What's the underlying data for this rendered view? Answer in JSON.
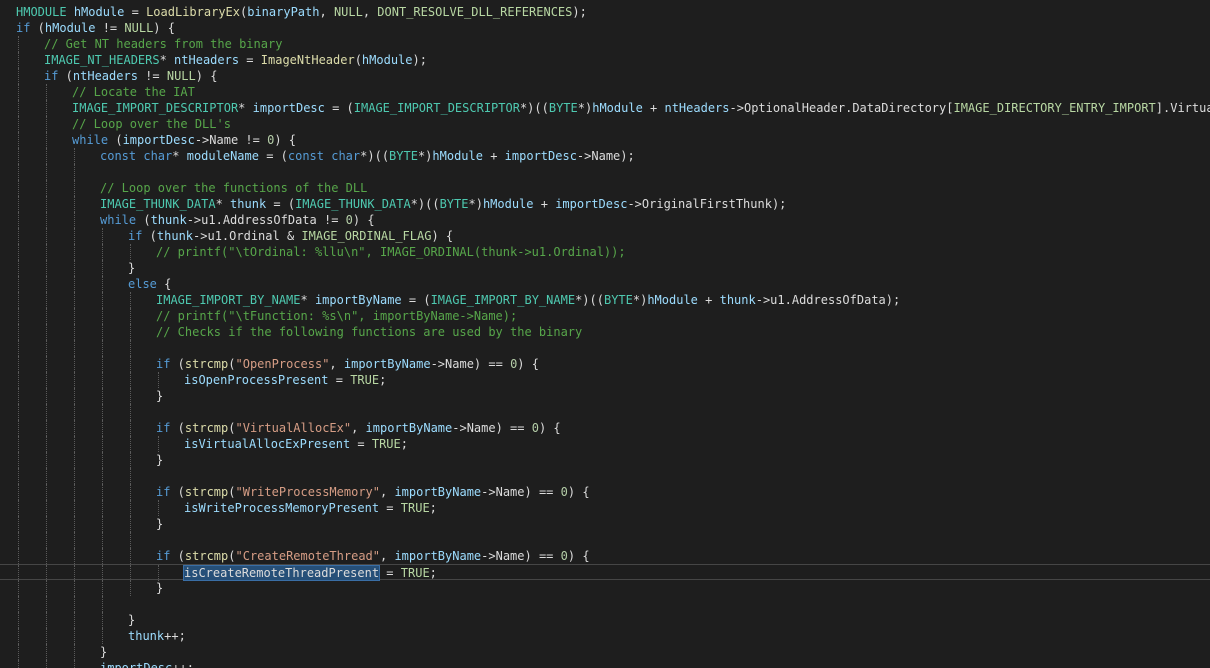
{
  "editor": {
    "language": "C++",
    "colors": {
      "background": "#1e1e1e",
      "keyword": "#569cd6",
      "type": "#4ec9b0",
      "function": "#dcdcaa",
      "variable": "#9cdcfe",
      "macro": "#b8d7a3",
      "comment": "#57a64a",
      "string": "#d69d85",
      "selection": "#264f78"
    },
    "current_line": 35,
    "lines": [
      {
        "indent": 0,
        "tokens": [
          [
            "ty",
            "HMODULE"
          ],
          [
            "pl",
            " "
          ],
          [
            "va",
            "hModule"
          ],
          [
            "pl",
            " = "
          ],
          [
            "fn",
            "LoadLibraryEx"
          ],
          [
            "pl",
            "("
          ],
          [
            "va",
            "binaryPath"
          ],
          [
            "pl",
            ", "
          ],
          [
            "ma",
            "NULL"
          ],
          [
            "pl",
            ", "
          ],
          [
            "ma",
            "DONT_RESOLVE_DLL_REFERENCES"
          ],
          [
            "pl",
            ");"
          ]
        ]
      },
      {
        "indent": 0,
        "tokens": [
          [
            "kw",
            "if"
          ],
          [
            "pl",
            " ("
          ],
          [
            "va",
            "hModule"
          ],
          [
            "pl",
            " != "
          ],
          [
            "ma",
            "NULL"
          ],
          [
            "pl",
            ") {"
          ]
        ]
      },
      {
        "indent": 1,
        "tokens": [
          [
            "co",
            "// Get NT headers from the binary"
          ]
        ]
      },
      {
        "indent": 1,
        "tokens": [
          [
            "ty",
            "IMAGE_NT_HEADERS"
          ],
          [
            "pl",
            "* "
          ],
          [
            "va",
            "ntHeaders"
          ],
          [
            "pl",
            " = "
          ],
          [
            "fn",
            "ImageNtHeader"
          ],
          [
            "pl",
            "("
          ],
          [
            "va",
            "hModule"
          ],
          [
            "pl",
            ");"
          ]
        ]
      },
      {
        "indent": 1,
        "tokens": [
          [
            "kw",
            "if"
          ],
          [
            "pl",
            " ("
          ],
          [
            "va",
            "ntHeaders"
          ],
          [
            "pl",
            " != "
          ],
          [
            "ma",
            "NULL"
          ],
          [
            "pl",
            ") {"
          ]
        ]
      },
      {
        "indent": 2,
        "tokens": [
          [
            "co",
            "// Locate the IAT"
          ]
        ]
      },
      {
        "indent": 2,
        "tokens": [
          [
            "ty",
            "IMAGE_IMPORT_DESCRIPTOR"
          ],
          [
            "pl",
            "* "
          ],
          [
            "va",
            "importDesc"
          ],
          [
            "pl",
            " = ("
          ],
          [
            "ty",
            "IMAGE_IMPORT_DESCRIPTOR"
          ],
          [
            "pl",
            "*)(("
          ],
          [
            "ty",
            "BYTE"
          ],
          [
            "pl",
            "*)"
          ],
          [
            "va",
            "hModule"
          ],
          [
            "pl",
            " + "
          ],
          [
            "va",
            "ntHeaders"
          ],
          [
            "pl",
            "->OptionalHeader.DataDirectory["
          ],
          [
            "ma",
            "IMAGE_DIRECTORY_ENTRY_IMPORT"
          ],
          [
            "pl",
            "].VirtualAddr"
          ]
        ]
      },
      {
        "indent": 2,
        "tokens": [
          [
            "co",
            "// Loop over the DLL's"
          ]
        ]
      },
      {
        "indent": 2,
        "tokens": [
          [
            "kw",
            "while"
          ],
          [
            "pl",
            " ("
          ],
          [
            "va",
            "importDesc"
          ],
          [
            "pl",
            "->Name != "
          ],
          [
            "nu",
            "0"
          ],
          [
            "pl",
            ") {"
          ]
        ]
      },
      {
        "indent": 3,
        "tokens": [
          [
            "kw",
            "const"
          ],
          [
            "pl",
            " "
          ],
          [
            "kw",
            "char"
          ],
          [
            "pl",
            "* "
          ],
          [
            "va",
            "moduleName"
          ],
          [
            "pl",
            " = ("
          ],
          [
            "kw",
            "const"
          ],
          [
            "pl",
            " "
          ],
          [
            "kw",
            "char"
          ],
          [
            "pl",
            "*)(("
          ],
          [
            "ty",
            "BYTE"
          ],
          [
            "pl",
            "*)"
          ],
          [
            "va",
            "hModule"
          ],
          [
            "pl",
            " + "
          ],
          [
            "va",
            "importDesc"
          ],
          [
            "pl",
            "->Name);"
          ]
        ]
      },
      {
        "indent": 3,
        "tokens": []
      },
      {
        "indent": 3,
        "tokens": [
          [
            "co",
            "// Loop over the functions of the DLL"
          ]
        ]
      },
      {
        "indent": 3,
        "tokens": [
          [
            "ty",
            "IMAGE_THUNK_DATA"
          ],
          [
            "pl",
            "* "
          ],
          [
            "va",
            "thunk"
          ],
          [
            "pl",
            " = ("
          ],
          [
            "ty",
            "IMAGE_THUNK_DATA"
          ],
          [
            "pl",
            "*)(("
          ],
          [
            "ty",
            "BYTE"
          ],
          [
            "pl",
            "*)"
          ],
          [
            "va",
            "hModule"
          ],
          [
            "pl",
            " + "
          ],
          [
            "va",
            "importDesc"
          ],
          [
            "pl",
            "->OriginalFirstThunk);"
          ]
        ]
      },
      {
        "indent": 3,
        "tokens": [
          [
            "kw",
            "while"
          ],
          [
            "pl",
            " ("
          ],
          [
            "va",
            "thunk"
          ],
          [
            "pl",
            "->u1.AddressOfData != "
          ],
          [
            "nu",
            "0"
          ],
          [
            "pl",
            ") {"
          ]
        ]
      },
      {
        "indent": 4,
        "tokens": [
          [
            "kw",
            "if"
          ],
          [
            "pl",
            " ("
          ],
          [
            "va",
            "thunk"
          ],
          [
            "pl",
            "->u1.Ordinal & "
          ],
          [
            "ma",
            "IMAGE_ORDINAL_FLAG"
          ],
          [
            "pl",
            ") {"
          ]
        ]
      },
      {
        "indent": 5,
        "tokens": [
          [
            "co",
            "// printf(\"\\tOrdinal: %llu\\n\", IMAGE_ORDINAL(thunk->u1.Ordinal));"
          ]
        ]
      },
      {
        "indent": 4,
        "tokens": [
          [
            "pl",
            "}"
          ]
        ]
      },
      {
        "indent": 4,
        "tokens": [
          [
            "kw",
            "else"
          ],
          [
            "pl",
            " {"
          ]
        ]
      },
      {
        "indent": 5,
        "tokens": [
          [
            "ty",
            "IMAGE_IMPORT_BY_NAME"
          ],
          [
            "pl",
            "* "
          ],
          [
            "va",
            "importByName"
          ],
          [
            "pl",
            " = ("
          ],
          [
            "ty",
            "IMAGE_IMPORT_BY_NAME"
          ],
          [
            "pl",
            "*)(("
          ],
          [
            "ty",
            "BYTE"
          ],
          [
            "pl",
            "*)"
          ],
          [
            "va",
            "hModule"
          ],
          [
            "pl",
            " + "
          ],
          [
            "va",
            "thunk"
          ],
          [
            "pl",
            "->u1.AddressOfData);"
          ]
        ]
      },
      {
        "indent": 5,
        "tokens": [
          [
            "co",
            "// printf(\"\\tFunction: %s\\n\", importByName->Name);"
          ]
        ]
      },
      {
        "indent": 5,
        "tokens": [
          [
            "co",
            "// Checks if the following functions are used by the binary"
          ]
        ]
      },
      {
        "indent": 5,
        "tokens": []
      },
      {
        "indent": 5,
        "tokens": [
          [
            "kw",
            "if"
          ],
          [
            "pl",
            " ("
          ],
          [
            "fn",
            "strcmp"
          ],
          [
            "pl",
            "("
          ],
          [
            "st",
            "\"OpenProcess\""
          ],
          [
            "pl",
            ", "
          ],
          [
            "va",
            "importByName"
          ],
          [
            "pl",
            "->Name) == "
          ],
          [
            "nu",
            "0"
          ],
          [
            "pl",
            ") {"
          ]
        ]
      },
      {
        "indent": 6,
        "tokens": [
          [
            "va",
            "isOpenProcessPresent"
          ],
          [
            "pl",
            " = "
          ],
          [
            "ma",
            "TRUE"
          ],
          [
            "pl",
            ";"
          ]
        ]
      },
      {
        "indent": 5,
        "tokens": [
          [
            "pl",
            "}"
          ]
        ]
      },
      {
        "indent": 5,
        "tokens": []
      },
      {
        "indent": 5,
        "tokens": [
          [
            "kw",
            "if"
          ],
          [
            "pl",
            " ("
          ],
          [
            "fn",
            "strcmp"
          ],
          [
            "pl",
            "("
          ],
          [
            "st",
            "\"VirtualAllocEx\""
          ],
          [
            "pl",
            ", "
          ],
          [
            "va",
            "importByName"
          ],
          [
            "pl",
            "->Name) == "
          ],
          [
            "nu",
            "0"
          ],
          [
            "pl",
            ") {"
          ]
        ]
      },
      {
        "indent": 6,
        "tokens": [
          [
            "va",
            "isVirtualAllocExPresent"
          ],
          [
            "pl",
            " = "
          ],
          [
            "ma",
            "TRUE"
          ],
          [
            "pl",
            ";"
          ]
        ]
      },
      {
        "indent": 5,
        "tokens": [
          [
            "pl",
            "}"
          ]
        ]
      },
      {
        "indent": 5,
        "tokens": []
      },
      {
        "indent": 5,
        "tokens": [
          [
            "kw",
            "if"
          ],
          [
            "pl",
            " ("
          ],
          [
            "fn",
            "strcmp"
          ],
          [
            "pl",
            "("
          ],
          [
            "st",
            "\"WriteProcessMemory\""
          ],
          [
            "pl",
            ", "
          ],
          [
            "va",
            "importByName"
          ],
          [
            "pl",
            "->Name) == "
          ],
          [
            "nu",
            "0"
          ],
          [
            "pl",
            ") {"
          ]
        ]
      },
      {
        "indent": 6,
        "tokens": [
          [
            "va",
            "isWriteProcessMemoryPresent"
          ],
          [
            "pl",
            " = "
          ],
          [
            "ma",
            "TRUE"
          ],
          [
            "pl",
            ";"
          ]
        ]
      },
      {
        "indent": 5,
        "tokens": [
          [
            "pl",
            "}"
          ]
        ]
      },
      {
        "indent": 5,
        "tokens": []
      },
      {
        "indent": 5,
        "tokens": [
          [
            "kw",
            "if"
          ],
          [
            "pl",
            " ("
          ],
          [
            "fn",
            "strcmp"
          ],
          [
            "pl",
            "("
          ],
          [
            "st",
            "\"CreateRemoteThread\""
          ],
          [
            "pl",
            ", "
          ],
          [
            "va",
            "importByName"
          ],
          [
            "pl",
            "->Name) == "
          ],
          [
            "nu",
            "0"
          ],
          [
            "pl",
            ") {"
          ]
        ]
      },
      {
        "indent": 6,
        "tokens": [
          [
            "sel",
            "isCreateRemoteThreadPresent"
          ],
          [
            "pl",
            " = "
          ],
          [
            "ma",
            "TRUE"
          ],
          [
            "pl",
            ";"
          ]
        ]
      },
      {
        "indent": 5,
        "tokens": [
          [
            "pl",
            "}"
          ]
        ]
      },
      {
        "indent": 4,
        "tokens": []
      },
      {
        "indent": 4,
        "tokens": [
          [
            "pl",
            "}"
          ]
        ]
      },
      {
        "indent": 4,
        "tokens": [
          [
            "va",
            "thunk"
          ],
          [
            "pl",
            "++;"
          ]
        ]
      },
      {
        "indent": 3,
        "tokens": [
          [
            "pl",
            "}"
          ]
        ]
      },
      {
        "indent": 3,
        "tokens": [
          [
            "va",
            "importDesc"
          ],
          [
            "pl",
            "++;"
          ]
        ]
      }
    ]
  }
}
